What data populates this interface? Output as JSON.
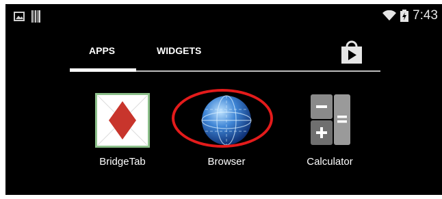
{
  "status_bar": {
    "time": "7:43",
    "left_icons": [
      "image-notification-icon",
      "barcode-notification-icon"
    ],
    "right_icons": [
      "wifi-icon",
      "battery-charging-icon"
    ]
  },
  "tabs": [
    {
      "label": "APPS",
      "selected": true
    },
    {
      "label": "WIDGETS",
      "selected": false
    }
  ],
  "apps": [
    {
      "label": "BridgeTab",
      "icon": "bridgetab-icon"
    },
    {
      "label": "Browser",
      "icon": "browser-globe-icon",
      "highlighted": true
    },
    {
      "label": "Calculator",
      "icon": "calculator-icon"
    }
  ],
  "colors": {
    "background": "#000000",
    "highlight": "#e31b1b",
    "bridgetab_red": "#c8352c",
    "bridgetab_border": "#8cc08a"
  }
}
